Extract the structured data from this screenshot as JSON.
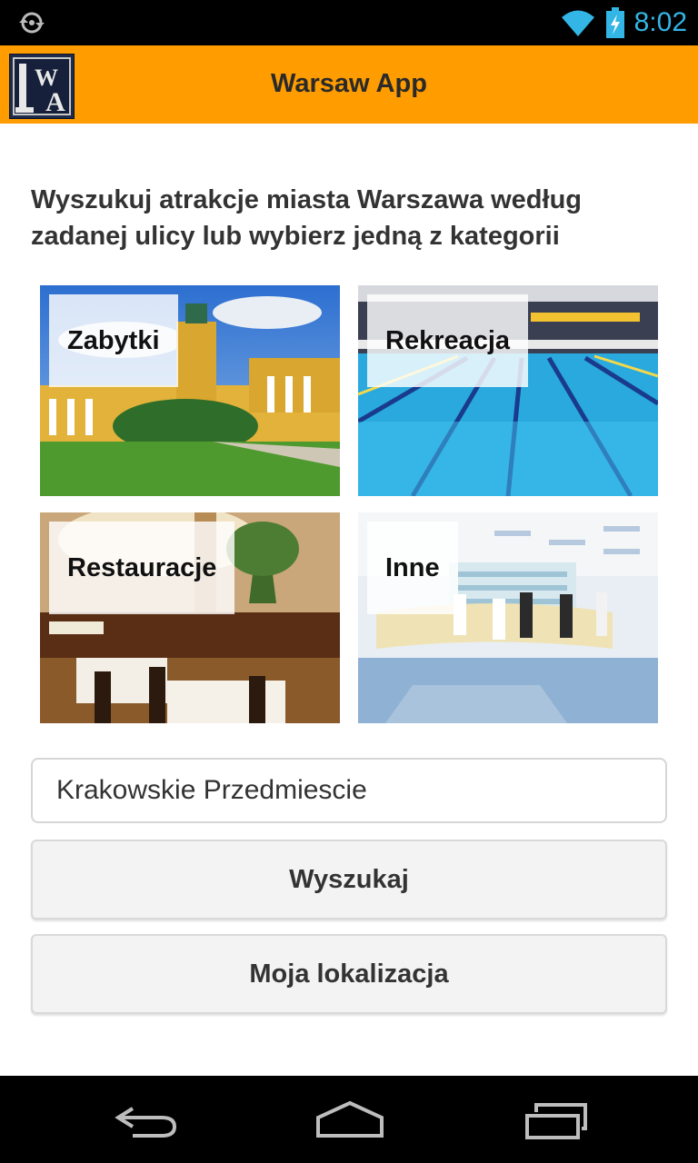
{
  "status_bar": {
    "time": "8:02",
    "icons": [
      "sync-icon",
      "wifi-icon",
      "battery-charging-icon"
    ]
  },
  "action_bar": {
    "title": "Warsaw App",
    "logo_text": "WA"
  },
  "main": {
    "heading": "Wyszukuj atrakcje miasta Warszawa według zadanej ulicy lub wybierz jedną z kategorii",
    "categories": [
      {
        "label": "Zabytki"
      },
      {
        "label": "Rekreacja"
      },
      {
        "label": "Restauracje"
      },
      {
        "label": "Inne"
      }
    ],
    "street_input": {
      "value": "Krakowskie Przedmiescie",
      "placeholder": ""
    },
    "search_button": "Wyszukaj",
    "location_button": "Moja lokalizacja"
  },
  "nav_bar": {
    "icons": [
      "back-icon",
      "home-icon",
      "recent-apps-icon"
    ]
  },
  "colors": {
    "accent": "#ff9c00",
    "status_time": "#33b5e5"
  }
}
